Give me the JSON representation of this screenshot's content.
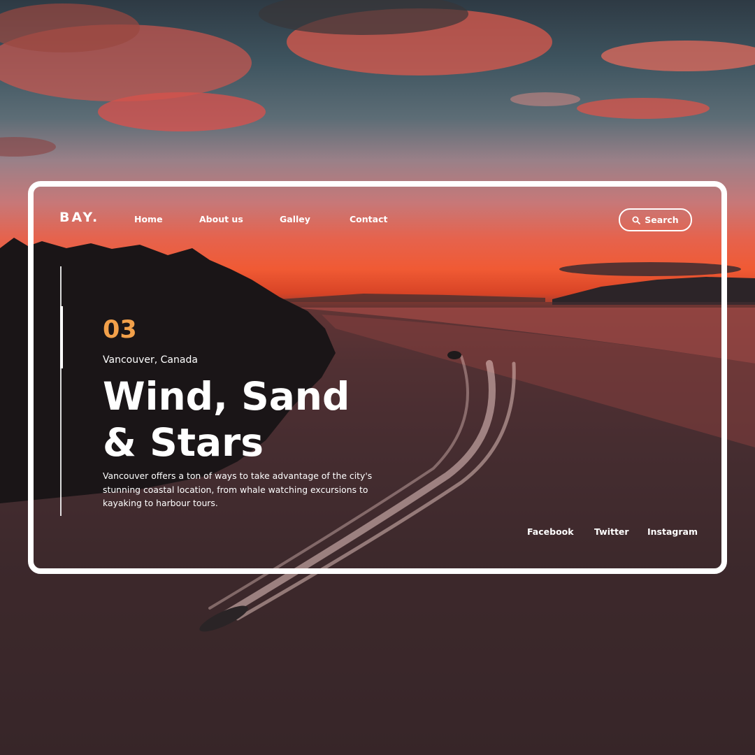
{
  "brand": {
    "logo": "BAY."
  },
  "nav": {
    "items": [
      {
        "label": "Home"
      },
      {
        "label": "About us"
      },
      {
        "label": "Galley"
      },
      {
        "label": "Contact"
      }
    ],
    "search_label": "Search"
  },
  "hero": {
    "slide_number": "03",
    "location": "Vancouver, Canada",
    "headline_line1": "Wind, Sand",
    "headline_line2": "& Stars",
    "description": "Vancouver offers a ton of ways to take advantage of the city's stunning coastal location, from whale watching excursions to kayaking to harbour tours."
  },
  "social": {
    "facebook": "Facebook",
    "twitter": "Twitter",
    "instagram": "Instagram"
  },
  "colors": {
    "accent": "#f2a04a",
    "frame": "#ffffff",
    "text": "#ffffff"
  }
}
